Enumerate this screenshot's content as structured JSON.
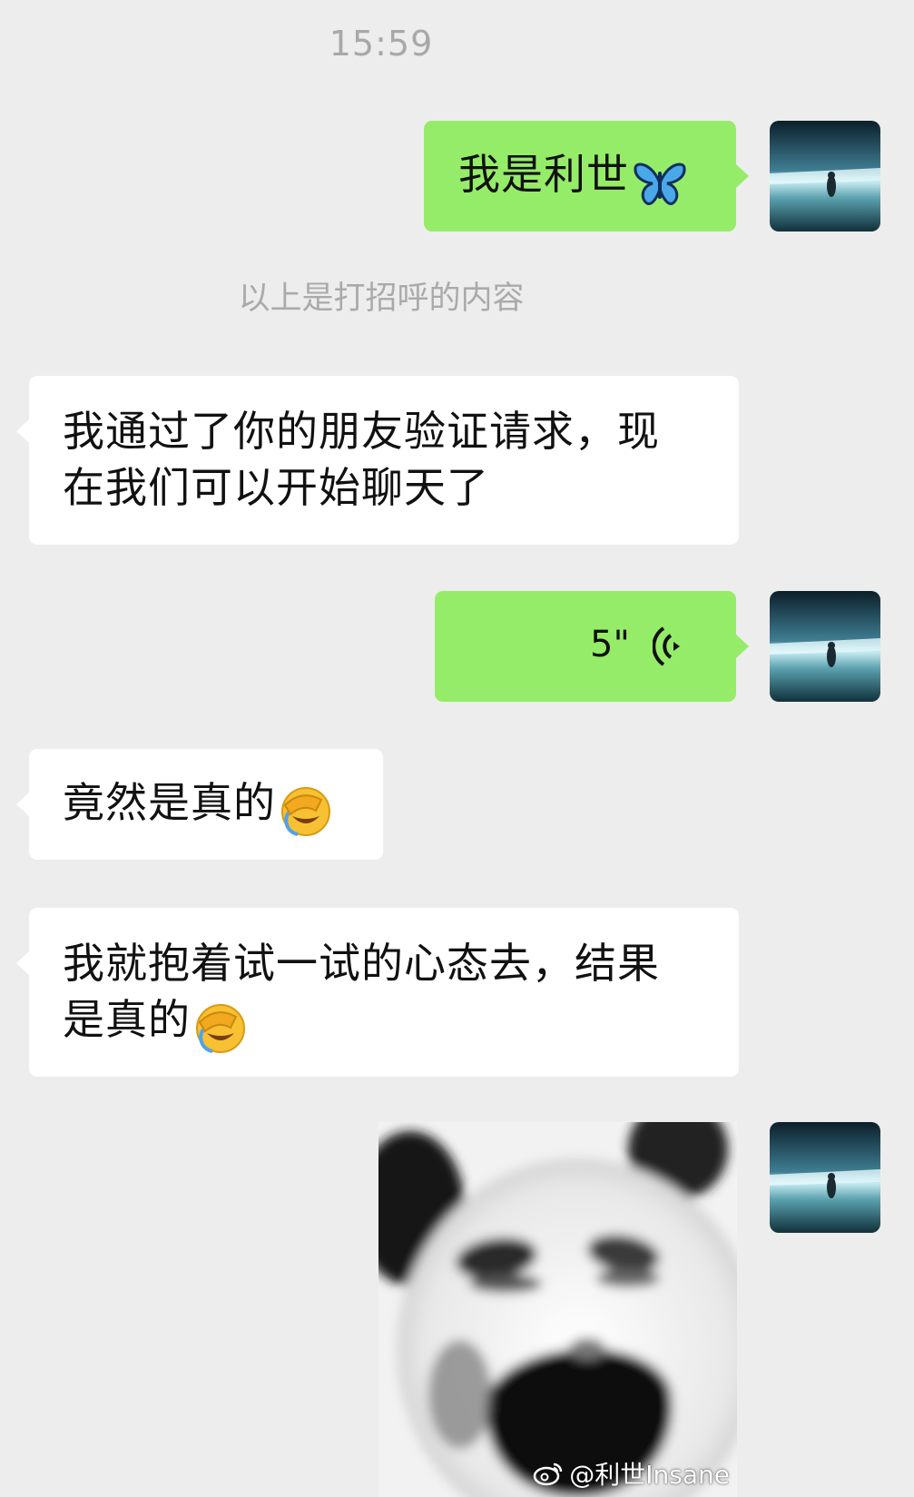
{
  "chat": {
    "timestamp": "15:59",
    "greeting_note": "以上是打招呼的内容",
    "messages": [
      {
        "side": "right",
        "type": "text",
        "text": "我是利世",
        "emoji": "butterfly"
      },
      {
        "side": "left",
        "type": "text",
        "line1": "我通过了你的朋友验证请求，现",
        "line2": "在我们可以开始聊天了"
      },
      {
        "side": "right",
        "type": "voice",
        "duration": "5\""
      },
      {
        "side": "left",
        "type": "text",
        "text": "竟然是真的",
        "emoji": "face-palm-crying"
      },
      {
        "side": "left",
        "type": "text",
        "line1": "我就抱着试一试的心态去，结果",
        "line2": "是真的",
        "emoji": "face-palm-crying"
      },
      {
        "side": "right",
        "type": "sticker",
        "sticker": "panda-face-meme"
      }
    ]
  },
  "watermark": {
    "text": "@利世Insane",
    "icon": "weibo-icon"
  },
  "colors": {
    "background": "#ededed",
    "right_bubble": "#95ec69",
    "left_bubble": "#ffffff",
    "meta_text": "#a8a8a8"
  }
}
